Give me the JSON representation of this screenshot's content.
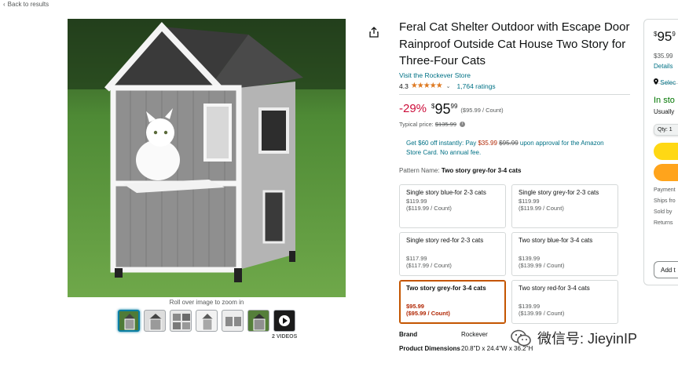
{
  "nav": {
    "back_label": "Back to results"
  },
  "gallery": {
    "zoom_hint": "Roll over image to zoom in",
    "videos_label": "2 VIDEOS"
  },
  "product": {
    "title": "Feral Cat Shelter Outdoor with Escape Door Rainproof Outside Cat House Two Story for Three-Four Cats",
    "store_link": "Visit the Rockever Store",
    "rating": "4.3",
    "stars": "★★★★★",
    "ratings_count": "1,764 ratings",
    "discount": "-29%",
    "price_symbol": "$",
    "price_whole": "95",
    "price_fraction": "99",
    "unit_price": "($95.99 / Count)",
    "typical_label": "Typical price:",
    "typical_price": "$135.99"
  },
  "promo": {
    "text_a": "Get $60 off instantly: Pay ",
    "new_price": "$35.99",
    "old_price": "$95.99",
    "text_b": " upon approval for the Amazon Store Card. No annual fee."
  },
  "pattern": {
    "label": "Pattern Name:",
    "value": "Two story grey-for 3-4 cats"
  },
  "options": [
    {
      "name": "Single story blue-for 2-3 cats",
      "price": "$119.99",
      "unit": "($119.99 / Count)"
    },
    {
      "name": "Single story grey-for 2-3 cats",
      "price": "$119.99",
      "unit": "($119.99 / Count)"
    },
    {
      "name": "Single story red-for 2-3 cats",
      "price": "$117.99",
      "unit": "($117.99 / Count)"
    },
    {
      "name": "Two story blue-for 3-4 cats",
      "price": "$139.99",
      "unit": "($139.99 / Count)"
    },
    {
      "name": "Two story grey-for 3-4 cats",
      "price": "$95.99",
      "unit": "($95.99 / Count)",
      "selected": true
    },
    {
      "name": "Two story red-for 3-4 cats",
      "price": "$139.99",
      "unit": "($139.99 / Count)"
    }
  ],
  "specs": {
    "brand_label": "Brand",
    "brand_value": "Rockever",
    "dims_label": "Product Dimensions",
    "dims_value": "20.8\"D x 24.4\"W x 36.2\"H"
  },
  "buybox": {
    "price_symbol": "$",
    "price_whole": "95",
    "price_fraction": "9",
    "delivery_price": "$35.99",
    "details": "Details",
    "location": "Selec",
    "in_stock": "In sto",
    "usually": "Usually",
    "qty": "Qty: 1",
    "payment": "Payment",
    "ships_from": "Ships fro",
    "sold_by": "Sold by",
    "returns": "Returns",
    "add_to_list": "Add t"
  },
  "watermark": {
    "text": "微信号: JieyinIP"
  },
  "colors": {
    "link": "#007185",
    "deal_red": "#cc0c39",
    "cart_yellow": "#ffd814",
    "buy_orange": "#ffa41c",
    "stock_green": "#007600"
  }
}
